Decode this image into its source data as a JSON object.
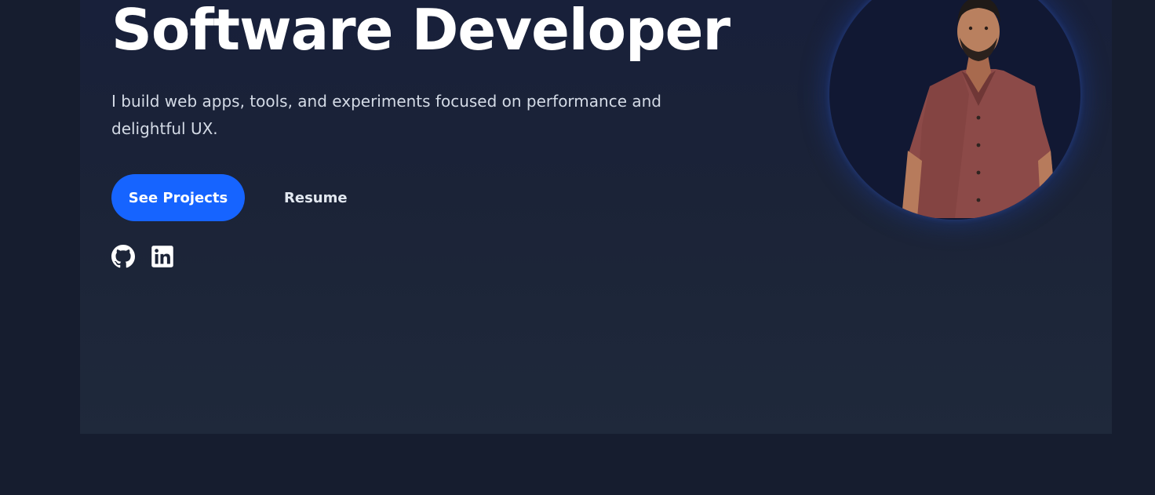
{
  "hero": {
    "title": "Software Developer",
    "description": "I build web apps, tools, and experiments focused on performance and delightful UX.",
    "primary_button_label": "See Projects",
    "secondary_button_label": "Resume",
    "socials": [
      {
        "icon": "github-icon"
      },
      {
        "icon": "linkedin-icon"
      }
    ],
    "avatar": "portrait-photo"
  },
  "colors": {
    "background": "#161d2f",
    "card": "#1b2337",
    "accent": "#1664ff",
    "title": "#ffffff",
    "text": "#d4dbe6"
  }
}
